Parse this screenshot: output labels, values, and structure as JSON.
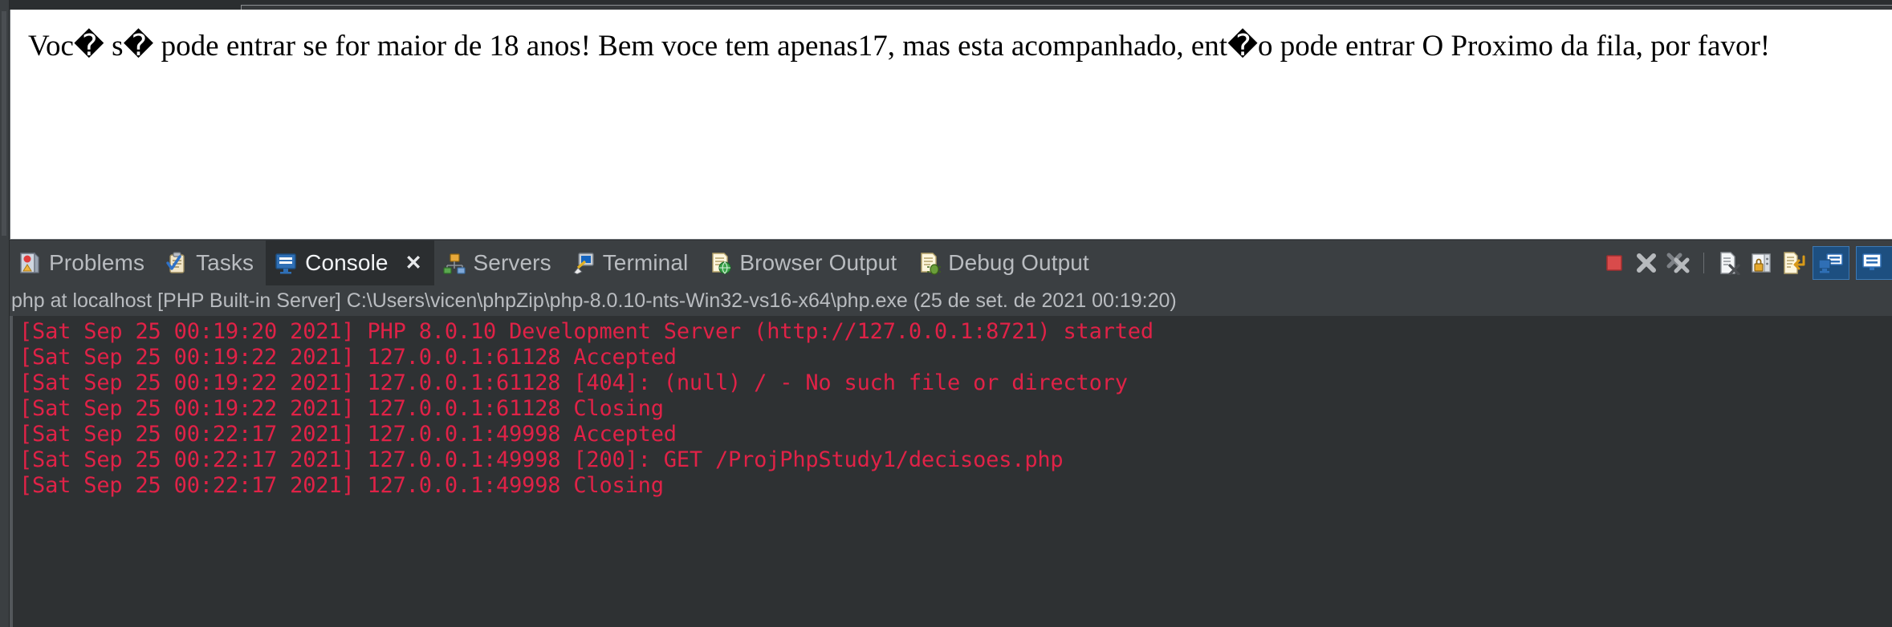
{
  "preview": {
    "text": "Voc� s� pode entrar se for maior de 18 anos! Bem voce tem apenas17, mas esta acompanhado, ent�o pode entrar O Proximo da fila, por favor!"
  },
  "view": {
    "tabs": [
      {
        "label": "Problems",
        "icon": "problems-icon",
        "active": false,
        "closable": false
      },
      {
        "label": "Tasks",
        "icon": "tasks-icon",
        "active": false,
        "closable": false
      },
      {
        "label": "Console",
        "icon": "console-icon",
        "active": true,
        "closable": true,
        "close_label": "✕"
      },
      {
        "label": "Servers",
        "icon": "servers-icon",
        "active": false,
        "closable": false
      },
      {
        "label": "Terminal",
        "icon": "terminal-icon",
        "active": false,
        "closable": false
      },
      {
        "label": "Browser Output",
        "icon": "browser-output-icon",
        "active": false,
        "closable": false
      },
      {
        "label": "Debug Output",
        "icon": "debug-output-icon",
        "active": false,
        "closable": false
      }
    ],
    "toolbar": [
      {
        "name": "terminate-button",
        "tooltip": "Terminate"
      },
      {
        "name": "remove-launch-button",
        "tooltip": "Remove Launch"
      },
      {
        "name": "remove-all-terminated-button",
        "tooltip": "Remove All Terminated Launches"
      },
      {
        "name": "clear-console-button",
        "tooltip": "Clear Console"
      },
      {
        "name": "scroll-lock-button",
        "tooltip": "Scroll Lock"
      },
      {
        "name": "word-wrap-button",
        "tooltip": "Word Wrap"
      },
      {
        "name": "display-selected-console-button",
        "tooltip": "Display Selected Console"
      },
      {
        "name": "open-console-button",
        "tooltip": "Open Console"
      }
    ],
    "console_title": "php at localhost [PHP Built-in Server] C:\\Users\\vicen\\phpZip\\php-8.0.10-nts-Win32-vs16-x64\\php.exe  (25 de set. de 2021 00:19:20)",
    "console_lines": [
      "[Sat Sep 25 00:19:20 2021] PHP 8.0.10 Development Server (http://127.0.0.1:8721) started",
      "[Sat Sep 25 00:19:22 2021] 127.0.0.1:61128 Accepted",
      "[Sat Sep 25 00:19:22 2021] 127.0.0.1:61128 [404]: (null) / - No such file or directory",
      "[Sat Sep 25 00:19:22 2021] 127.0.0.1:61128 Closing",
      "[Sat Sep 25 00:22:17 2021] 127.0.0.1:49998 Accepted",
      "[Sat Sep 25 00:22:17 2021] 127.0.0.1:49998 [200]: GET /ProjPhpStudy1/decisoes.php",
      "[Sat Sep 25 00:22:17 2021] 127.0.0.1:49998 Closing"
    ]
  },
  "colors": {
    "console_text": "#e02247",
    "console_background": "#2e3133",
    "tab_active_background": "#2b2e30",
    "tab_bar_background": "#3b3f42",
    "tab_label": "#b9bcc0",
    "preview_background": "#ffffff",
    "stop_icon_red": "#d94b4b"
  }
}
